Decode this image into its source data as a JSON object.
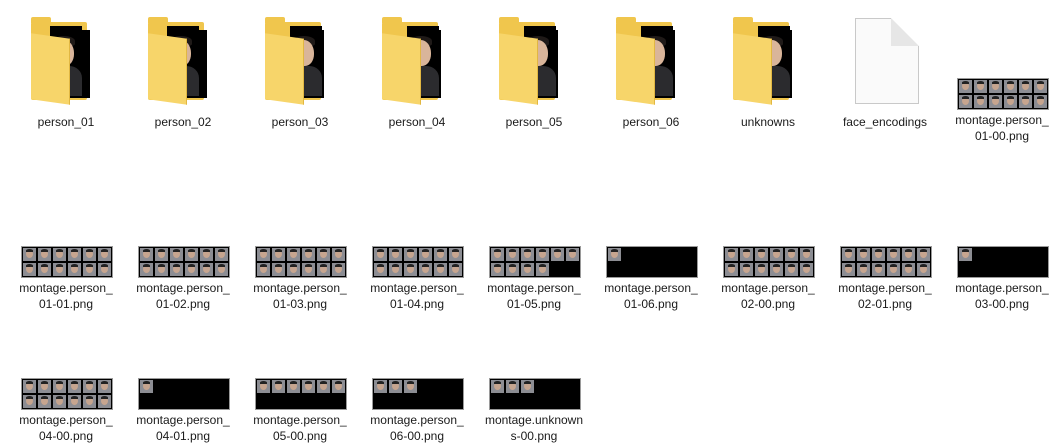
{
  "items": [
    {
      "type": "folder",
      "label": "person_01",
      "photo_pos": "left"
    },
    {
      "type": "folder",
      "label": "person_02",
      "photo_pos": "left"
    },
    {
      "type": "folder",
      "label": "person_03",
      "photo_pos": "center"
    },
    {
      "type": "folder",
      "label": "person_04",
      "photo_pos": "center"
    },
    {
      "type": "folder",
      "label": "person_05",
      "photo_pos": "center"
    },
    {
      "type": "folder",
      "label": "person_06",
      "photo_pos": "center"
    },
    {
      "type": "folder",
      "label": "unknowns",
      "photo_pos": "center"
    },
    {
      "type": "file",
      "label": "face_encodings"
    },
    {
      "type": "image",
      "label": "montage.person_01-00.png",
      "fill": "full"
    },
    {
      "type": "image",
      "label": "montage.person_01-01.png",
      "fill": "full"
    },
    {
      "type": "image",
      "label": "montage.person_01-02.png",
      "fill": "full"
    },
    {
      "type": "image",
      "label": "montage.person_01-03.png",
      "fill": "full"
    },
    {
      "type": "image",
      "label": "montage.person_01-04.png",
      "fill": "full"
    },
    {
      "type": "image",
      "label": "montage.person_01-05.png",
      "fill": "mostly"
    },
    {
      "type": "image",
      "label": "montage.person_01-06.png",
      "fill": "one"
    },
    {
      "type": "image",
      "label": "montage.person_02-00.png",
      "fill": "full"
    },
    {
      "type": "image",
      "label": "montage.person_02-01.png",
      "fill": "full"
    },
    {
      "type": "image",
      "label": "montage.person_03-00.png",
      "fill": "one"
    },
    {
      "type": "image",
      "label": "montage.person_04-00.png",
      "fill": "full"
    },
    {
      "type": "image",
      "label": "montage.person_04-01.png",
      "fill": "one"
    },
    {
      "type": "image",
      "label": "montage.person_05-00.png",
      "fill": "row"
    },
    {
      "type": "image",
      "label": "montage.person_06-00.png",
      "fill": "few"
    },
    {
      "type": "image",
      "label": "montage.unknowns-00.png",
      "fill": "few"
    }
  ],
  "colors": {
    "folder": "#f0c64d",
    "folder_front": "#f7d56a",
    "background": "#ffffff",
    "text": "#1a1a1a"
  }
}
